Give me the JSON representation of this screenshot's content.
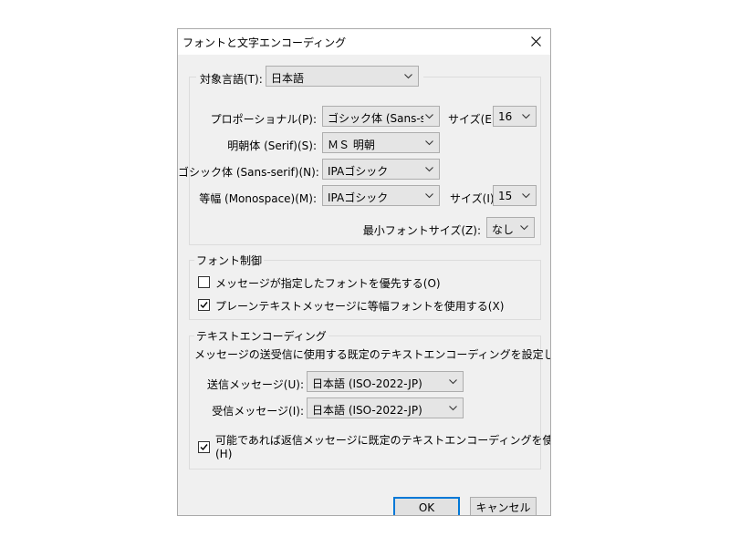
{
  "dialog": {
    "title": "フォントと文字エンコーディング",
    "close_icon": "close-icon"
  },
  "fonts": {
    "language_label": "対象言語(T):",
    "language_value": "日本語",
    "proportional_label": "プロポーショナル(P):",
    "proportional_value": "ゴシック体 (Sans-s...",
    "size_label_e": "サイズ(E):",
    "size_value_e": "16",
    "serif_label": "明朝体 (Serif)(S):",
    "serif_value": "ＭＳ 明朝",
    "sans_label": "ゴシック体 (Sans-serif)(N):",
    "sans_value": "IPAゴシック",
    "mono_label": "等幅 (Monospace)(M):",
    "mono_value": "IPAゴシック",
    "size_label_i": "サイズ(I):",
    "size_value_i": "15",
    "min_size_label": "最小フォントサイズ(Z):",
    "min_size_value": "なし"
  },
  "font_control": {
    "legend": "フォント制御",
    "allow_label": "メッセージが指定したフォントを優先する(O)",
    "allow_checked": false,
    "fixed_label": "プレーンテキストメッセージに等幅フォントを使用する(X)",
    "fixed_checked": true
  },
  "encoding": {
    "legend": "テキストエンコーディング",
    "description": "メッセージの送受信に使用する既定のテキストエンコーディングを設定します。",
    "outgoing_label": "送信メッセージ(U):",
    "outgoing_value": "日本語 (ISO-2022-JP)",
    "incoming_label": "受信メッセージ(I):",
    "incoming_value": "日本語 (ISO-2022-JP)",
    "reply_label_line1": "可能であれば返信メッセージに既定のテキストエンコーディングを使用する",
    "reply_label_line2": "(H)",
    "reply_checked": true
  },
  "buttons": {
    "ok": "OK",
    "cancel": "キャンセル"
  },
  "colors": {
    "dialog_bg": "#f0f0f0",
    "accent": "#0078d7"
  }
}
